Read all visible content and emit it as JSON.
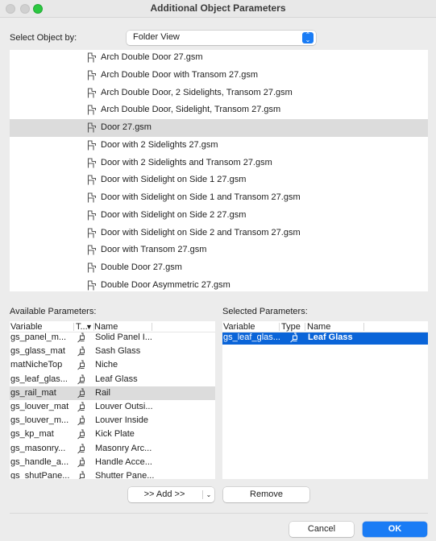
{
  "window": {
    "title": "Additional Object Parameters"
  },
  "select_object": {
    "label": "Select Object by:",
    "value": "Folder View"
  },
  "objects": [
    {
      "label": "Arch Double Door 27.gsm",
      "icon": "door-object-icon"
    },
    {
      "label": "Arch Double Door with Transom 27.gsm",
      "icon": "door-object-icon"
    },
    {
      "label": "Arch Double Door, 2 Sidelights, Transom 27.gsm",
      "icon": "door-object-icon"
    },
    {
      "label": "Arch Double Door, Sidelight, Transom 27.gsm",
      "icon": "door-object-icon"
    },
    {
      "label": "Door 27.gsm",
      "icon": "door-object-icon",
      "selected": true
    },
    {
      "label": "Door with 2 Sidelights 27.gsm",
      "icon": "door-object-icon"
    },
    {
      "label": "Door with 2 Sidelights and Transom 27.gsm",
      "icon": "door-object-icon"
    },
    {
      "label": "Door with Sidelight on Side 1 27.gsm",
      "icon": "door-object-icon"
    },
    {
      "label": "Door with Sidelight on Side 1 and Transom 27.gsm",
      "icon": "door-object-icon"
    },
    {
      "label": "Door with Sidelight on Side 2 27.gsm",
      "icon": "door-object-icon"
    },
    {
      "label": "Door with Sidelight on Side 2 and Transom 27.gsm",
      "icon": "door-object-icon"
    },
    {
      "label": "Door with Transom 27.gsm",
      "icon": "door-object-icon"
    },
    {
      "label": "Double Door 27.gsm",
      "icon": "door-object-icon"
    },
    {
      "label": "Double Door Asymmetric 27.gsm",
      "icon": "door-object-icon"
    }
  ],
  "available": {
    "label": "Available Parameters:",
    "columns": {
      "variable": "Variable",
      "type": "T...",
      "sort_indicator": "▼",
      "name": "Name"
    },
    "rows": [
      {
        "variable": "gs_panel_m...",
        "type": "material-brush-icon",
        "name": "Solid Panel I..."
      },
      {
        "variable": "gs_glass_mat",
        "type": "material-brush-icon",
        "name": "Sash Glass"
      },
      {
        "variable": "matNicheTop",
        "type": "material-brush-icon",
        "name": "Niche"
      },
      {
        "variable": "gs_leaf_glas...",
        "type": "material-brush-icon",
        "name": "Leaf Glass"
      },
      {
        "variable": "gs_rail_mat",
        "type": "material-brush-icon",
        "name": "Rail",
        "selected": true
      },
      {
        "variable": "gs_louver_mat",
        "type": "material-brush-icon",
        "name": "Louver Outsi..."
      },
      {
        "variable": "gs_louver_m...",
        "type": "material-brush-icon",
        "name": "Louver Inside"
      },
      {
        "variable": "gs_kp_mat",
        "type": "material-brush-icon",
        "name": "Kick Plate"
      },
      {
        "variable": "gs_masonry...",
        "type": "material-brush-icon",
        "name": "Masonry Arc..."
      },
      {
        "variable": "gs_handle_a...",
        "type": "material-brush-icon",
        "name": "Handle Acce..."
      },
      {
        "variable": "gs_shutPane...",
        "type": "material-brush-icon",
        "name": "Shutter Pane..."
      }
    ]
  },
  "selected": {
    "label": "Selected Parameters:",
    "columns": {
      "variable": "Variable",
      "type": "Type",
      "name": "Name"
    },
    "rows": [
      {
        "variable": "gs_leaf_glas...",
        "type": "material-brush-icon",
        "name": "Leaf Glass",
        "selected": true
      }
    ]
  },
  "buttons": {
    "add": ">> Add >>",
    "add_menu": "⌄",
    "remove": "Remove",
    "cancel": "Cancel",
    "ok": "OK"
  },
  "colors": {
    "accent": "#1a7cf5",
    "selection_blue": "#0a64d8",
    "selection_grey": "#dcdcdc",
    "window_bg": "#ececec",
    "traffic_green": "#2bc840"
  }
}
